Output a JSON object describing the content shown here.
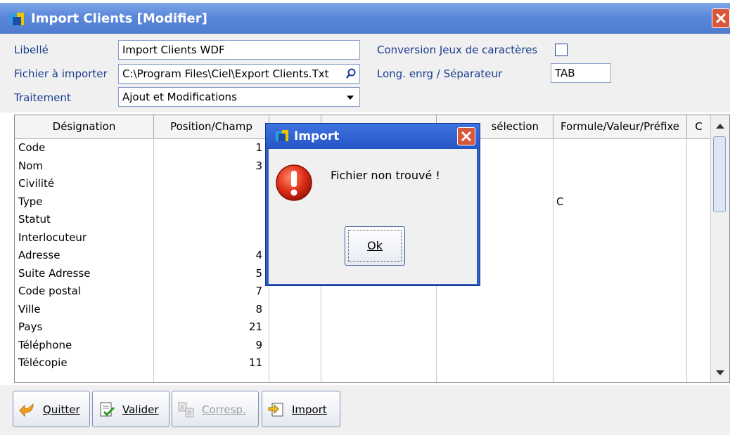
{
  "window": {
    "title": "Import Clients [Modifier]",
    "title_color": "#5a87d9"
  },
  "form": {
    "libelle_label": "Libellé",
    "libelle_value": "Import Clients WDF",
    "fichier_label": "Fichier à importer",
    "fichier_value": "C:\\Program Files\\Ciel\\Export Clients.Txt",
    "traitement_label": "Traitement",
    "traitement_value": "Ajout et Modifications",
    "conversion_label": "Conversion Jeux de caractères",
    "conversion_checked": false,
    "long_label": "Long. enrg / Séparateur",
    "long_value": "TAB"
  },
  "table": {
    "headers": [
      "Désignation",
      "Position/Champ",
      "",
      "",
      "sélection",
      "Formule/Valeur/Préfixe",
      "C"
    ],
    "rows": [
      {
        "name": "Code",
        "pos": "1",
        "formula": ""
      },
      {
        "name": "Nom",
        "pos": "3",
        "formula": ""
      },
      {
        "name": "Civilité",
        "pos": "",
        "formula": ""
      },
      {
        "name": "Type",
        "pos": "",
        "formula": "C"
      },
      {
        "name": "Statut",
        "pos": "",
        "formula": ""
      },
      {
        "name": "Interlocuteur",
        "pos": "",
        "formula": ""
      },
      {
        "name": "Adresse",
        "pos": "4",
        "formula": ""
      },
      {
        "name": "Suite Adresse",
        "pos": "5",
        "formula": ""
      },
      {
        "name": "Code postal",
        "pos": "7",
        "formula": ""
      },
      {
        "name": "Ville",
        "pos": "8",
        "formula": ""
      },
      {
        "name": "Pays",
        "pos": "21",
        "formula": ""
      },
      {
        "name": "Téléphone",
        "pos": "9",
        "formula": ""
      },
      {
        "name": "Télécopie",
        "pos": "11",
        "formula": ""
      }
    ]
  },
  "toolbar": {
    "quitter": "Quitter",
    "valider": "Valider",
    "corresp": "Corresp.",
    "import": "Import"
  },
  "dialog": {
    "title": "Import",
    "message": "Fichier non trouvé !",
    "ok_label": "Ok",
    "icon": "error-icon"
  }
}
